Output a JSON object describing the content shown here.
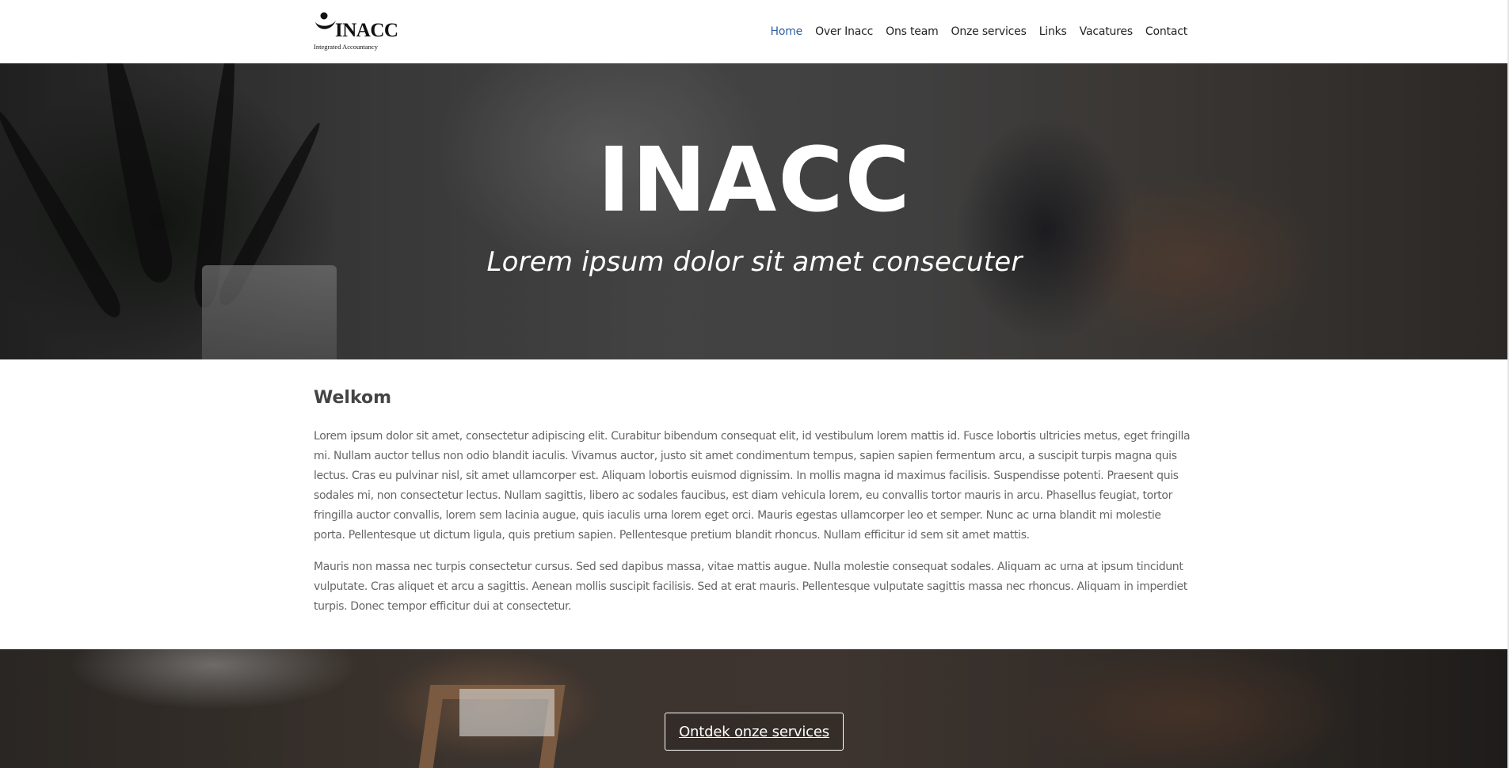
{
  "logo": {
    "name": "INACC",
    "tagline": "Integrated Accountancy"
  },
  "nav": {
    "items": [
      {
        "label": "Home",
        "active": true
      },
      {
        "label": "Over Inacc",
        "active": false
      },
      {
        "label": "Ons team",
        "active": false
      },
      {
        "label": "Onze services",
        "active": false
      },
      {
        "label": "Links",
        "active": false
      },
      {
        "label": "Vacatures",
        "active": false
      },
      {
        "label": "Contact",
        "active": false
      }
    ]
  },
  "hero": {
    "title": "INACC",
    "subtitle": "Lorem ipsum dolor sit amet consecuter"
  },
  "welcome": {
    "heading": "Welkom",
    "paragraphs": [
      "Lorem ipsum dolor sit amet, consectetur adipiscing elit. Curabitur bibendum consequat elit, id vestibulum lorem mattis id. Fusce lobortis ultricies metus, eget fringilla mi. Nullam auctor tellus non odio blandit iaculis. Vivamus auctor, justo sit amet condimentum tempus, sapien sapien fermentum arcu, a suscipit turpis magna quis lectus. Cras eu pulvinar nisl, sit amet ullamcorper est. Aliquam lobortis euismod dignissim. In mollis magna id maximus facilisis. Suspendisse potenti. Praesent quis sodales mi, non consectetur lectus. Nullam sagittis, libero ac sodales faucibus, est diam vehicula lorem, eu convallis tortor mauris in arcu. Phasellus feugiat, tortor fringilla auctor convallis, lorem sem lacinia augue, quis iaculis urna lorem eget orci. Mauris egestas ullamcorper leo et semper. Nunc ac urna blandit mi molestie porta. Pellentesque ut dictum ligula, quis pretium sapien. Pellentesque pretium blandit rhoncus. Nullam efficitur id sem sit amet mattis.",
      "Mauris non massa nec turpis consectetur cursus. Sed sed dapibus massa, vitae mattis augue. Nulla molestie consequat sodales. Aliquam ac urna at ipsum tincidunt vulputate. Cras aliquet et arcu a sagittis. Aenean mollis suscipit facilisis. Sed at erat mauris. Pellentesque vulputate sagittis massa nec rhoncus. Aliquam in imperdiet turpis. Donec tempor efficitur dui at consectetur."
    ]
  },
  "cta": {
    "label": "Ontdek onze services"
  },
  "colors": {
    "nav_active": "#2f5fa0",
    "nav_text": "#222222",
    "body_text": "#666666",
    "heading": "#444444"
  }
}
